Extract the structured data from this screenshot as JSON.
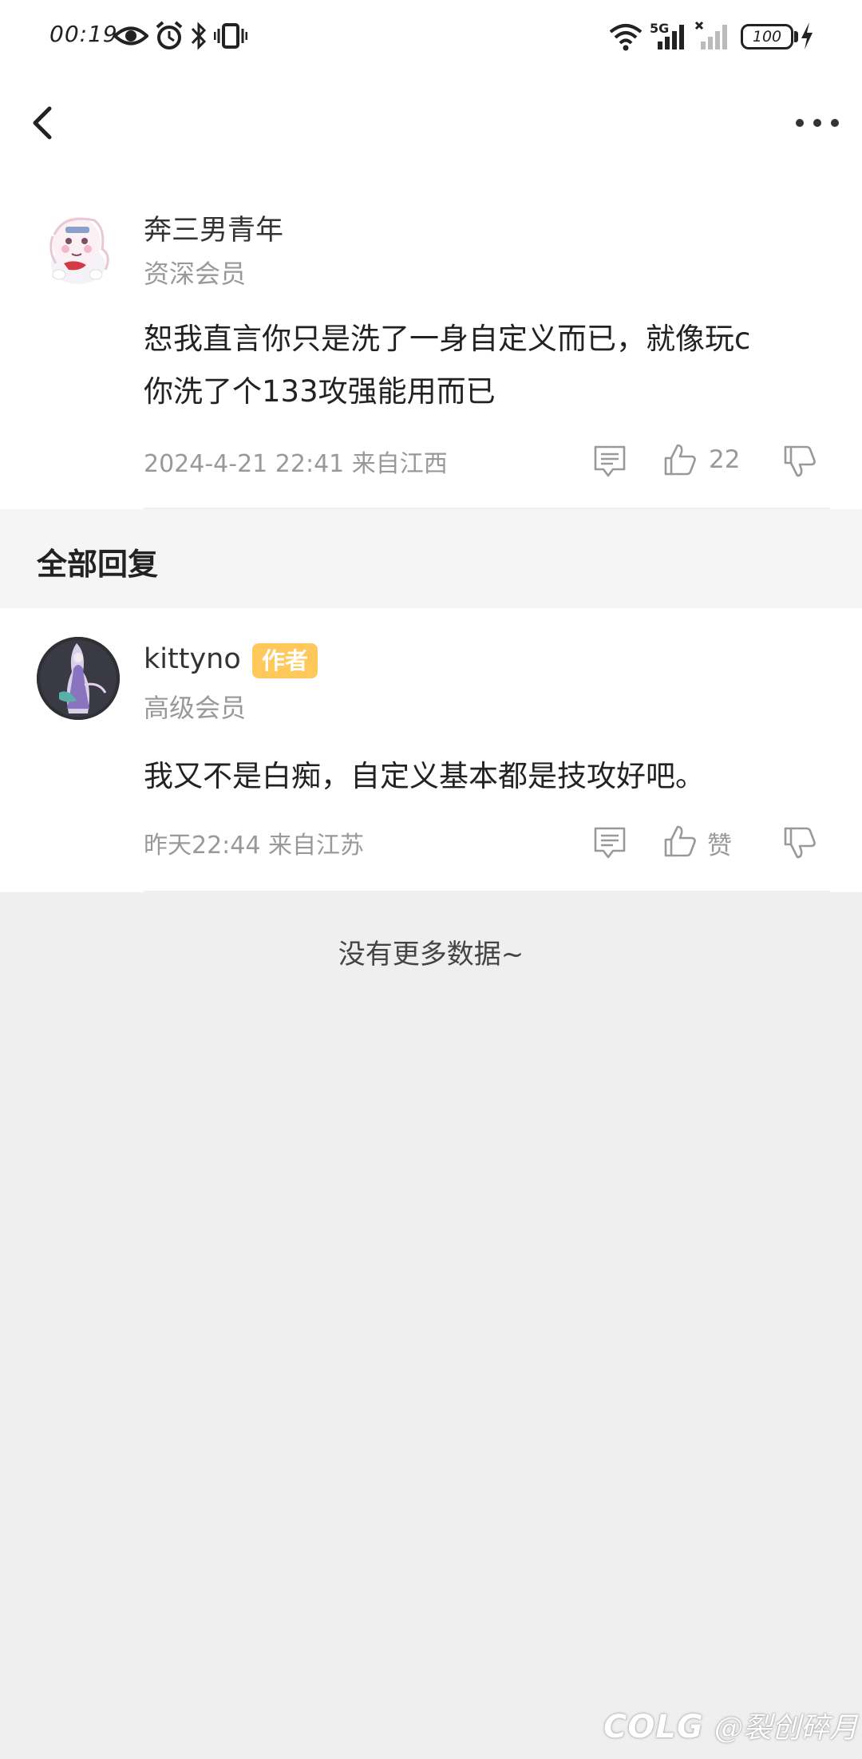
{
  "status_bar": {
    "time": "00:19",
    "network_label": "5G",
    "battery": "100",
    "icons": [
      "eye-icon",
      "alarm-icon",
      "bluetooth-icon",
      "vibrate-icon",
      "wifi-icon",
      "signal-5g-icon",
      "signal-no-sim-icon",
      "battery-icon",
      "charging-icon"
    ]
  },
  "nav": {
    "back_icon": "chevron-left-icon",
    "more_icon": "more-horizontal-icon"
  },
  "main_comment": {
    "username": "奔三男青年",
    "level": "资深会员",
    "text_line1": "恕我直言你只是洗了一身自定义而已，就像玩c",
    "text_line2": "你洗了个133攻强能用而已",
    "timestamp": "2024-4-21 22:41  来自江西",
    "likes": "22"
  },
  "section": {
    "title": "全部回复"
  },
  "reply": {
    "username": "kittyno",
    "badge": "作者",
    "level": "高级会员",
    "text": "我又不是白痴，自定义基本都是技攻好吧。",
    "timestamp": "昨天22:44 来自江苏",
    "like_label": "赞"
  },
  "footer": {
    "no_more": "没有更多数据~"
  },
  "watermark": {
    "brand": "COLG",
    "name": "@裂创碎月"
  },
  "colors": {
    "badge_bg": "#ffc85a",
    "secondary_text": "#999999",
    "page_bg": "#efefef"
  }
}
